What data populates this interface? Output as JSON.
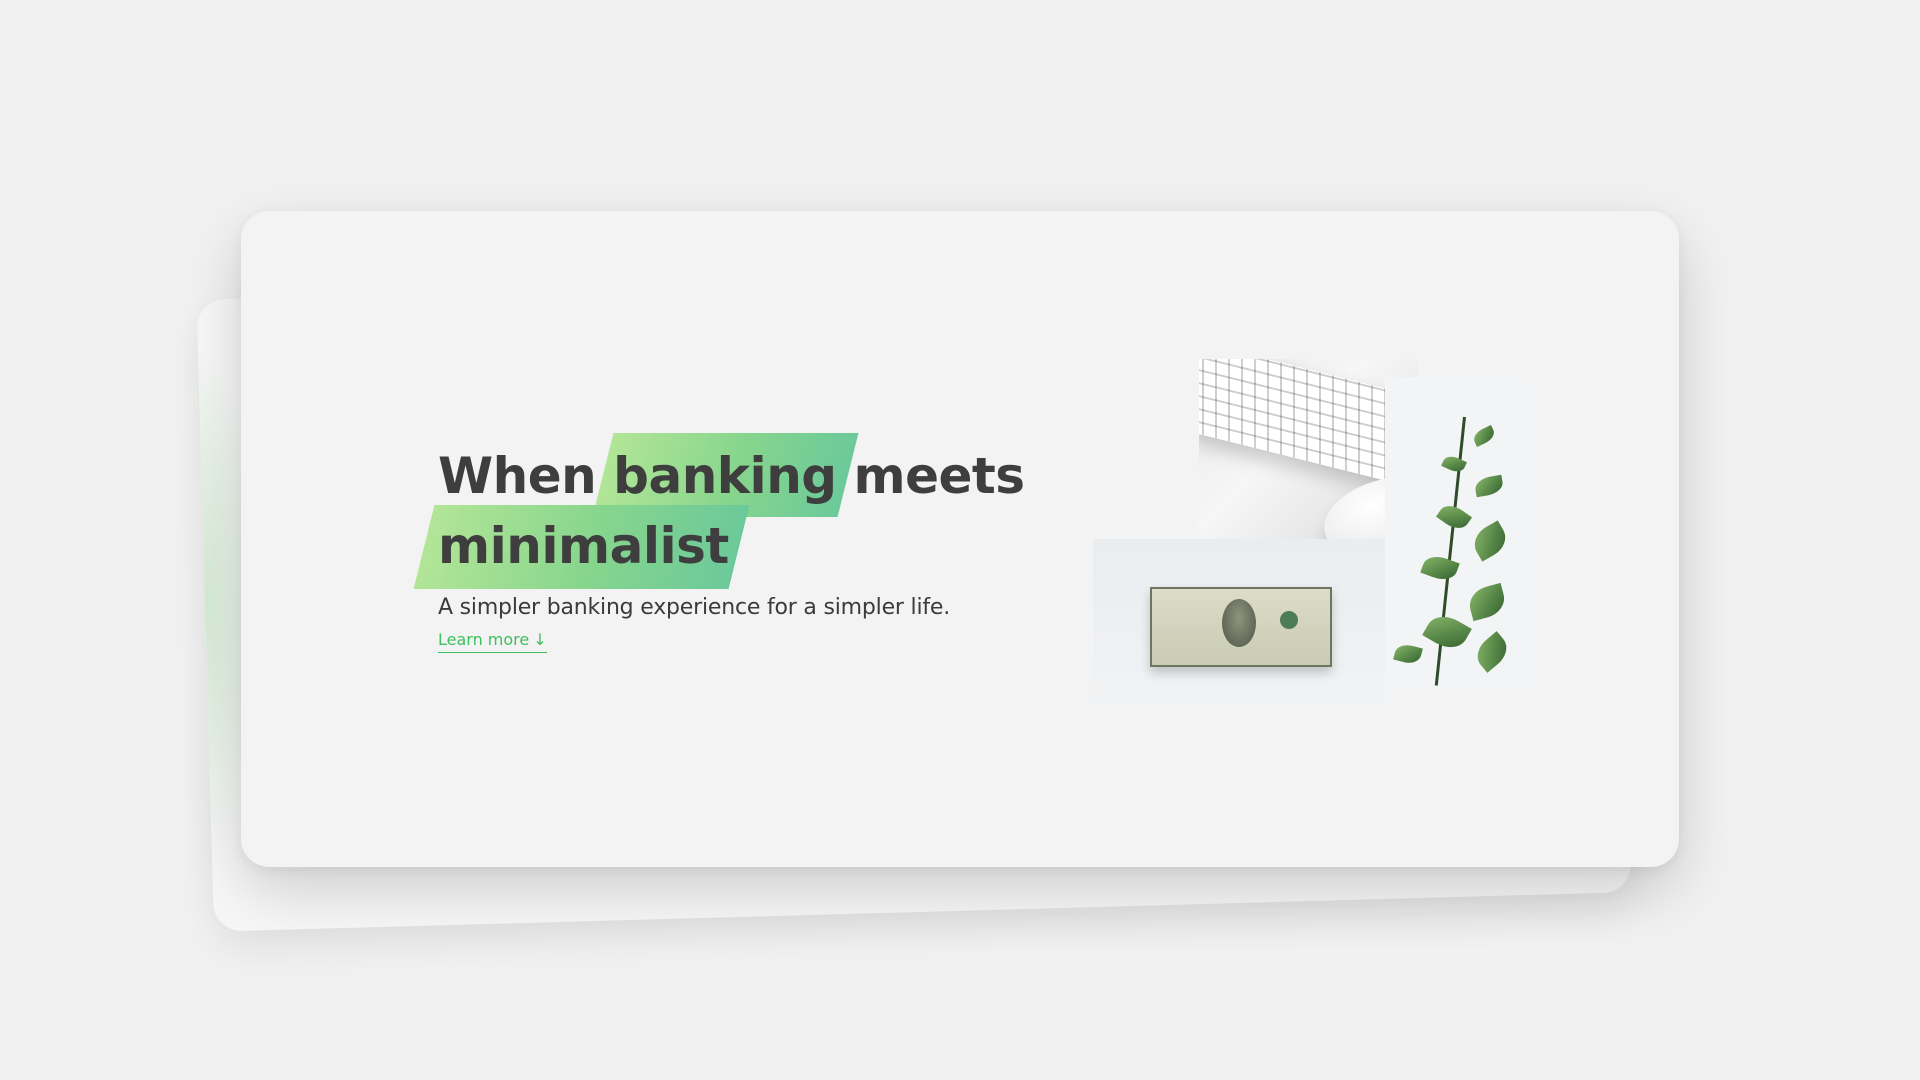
{
  "hero": {
    "headline": {
      "line1_before": "When ",
      "line1_highlight": "banking",
      "line1_after": " meets",
      "line2_highlight": "minimalist"
    },
    "subtitle": "A simpler banking experience for a simpler life.",
    "learn_more": {
      "label": "Learn more",
      "arrow": "↓"
    }
  },
  "colors": {
    "background": "#f1f1f1",
    "card": "#f3f3f3",
    "headline_text": "#3e3e3e",
    "highlight_gradient_start": "#b2e597",
    "highlight_gradient_end": "#6cc99a",
    "accent_link": "#3fbf5f"
  },
  "icons": {
    "learn_more_arrow": "arrow-down-icon"
  }
}
